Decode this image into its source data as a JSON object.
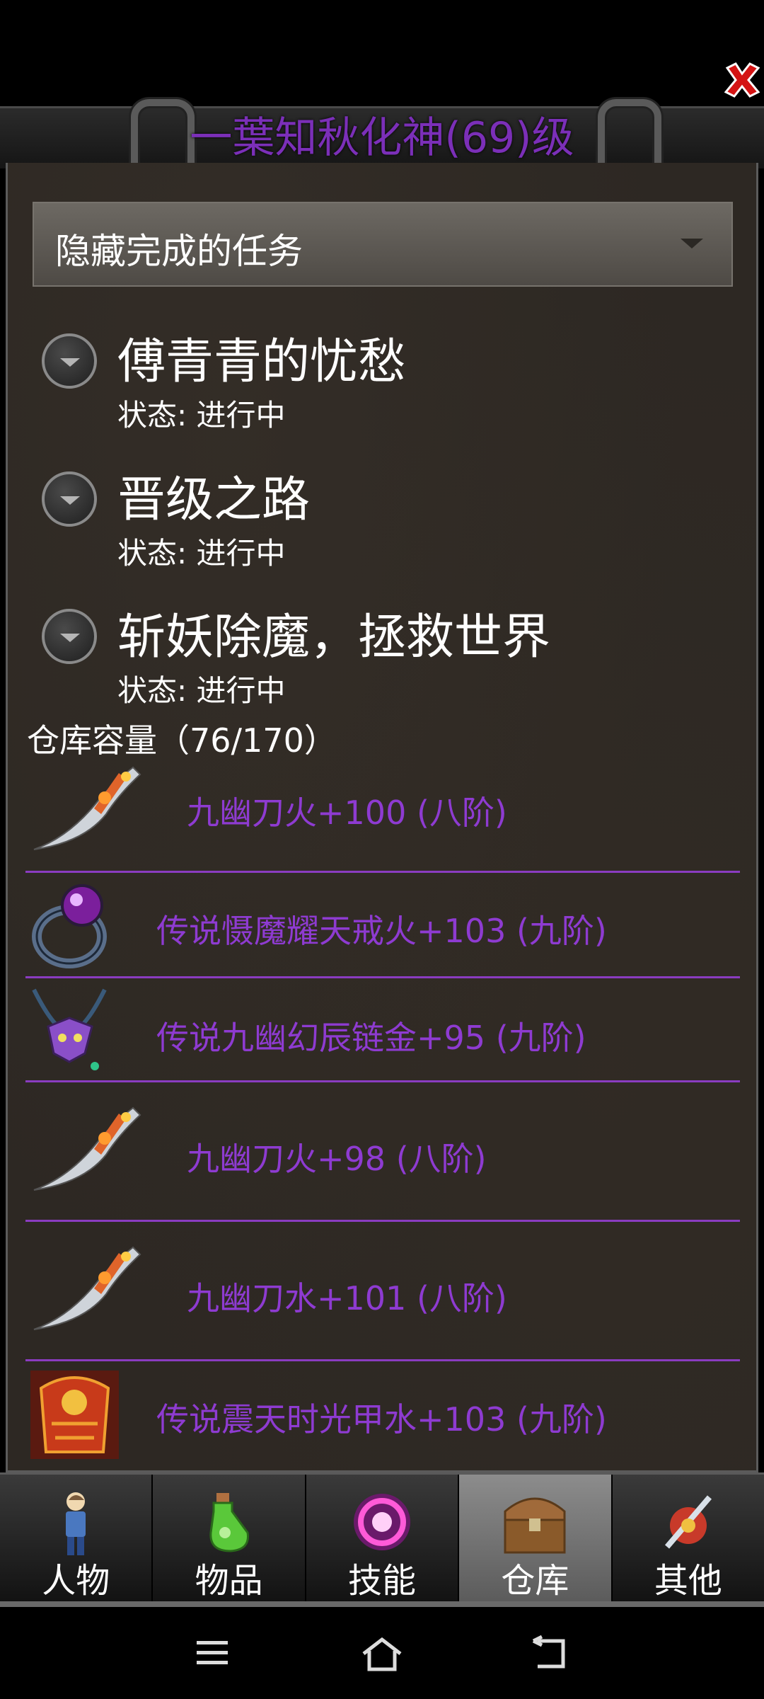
{
  "window": {
    "title": "一葉知秋化神(69)级",
    "close_icon": "close-x-icon"
  },
  "filter": {
    "selected": "隐藏完成的任务"
  },
  "quests": [
    {
      "title": "傅青青的忧愁",
      "status": "状态: 进行中"
    },
    {
      "title": "晋级之路",
      "status": "状态: 进行中"
    },
    {
      "title": "斩妖除魔，拯救世界",
      "status": "状态: 进行中"
    }
  ],
  "warehouse": {
    "capacity": "仓库容量（76/170）",
    "items": [
      {
        "name": "九幽刀火+100 (八阶)",
        "icon": "blade-icon"
      },
      {
        "name": "传说慑魔耀天戒火+103 (九阶)",
        "icon": "ring-icon"
      },
      {
        "name": "传说九幽幻辰链金+95 (九阶)",
        "icon": "necklace-icon"
      },
      {
        "name": "九幽刀火+98 (八阶)",
        "icon": "blade-icon"
      },
      {
        "name": "九幽刀水+101 (八阶)",
        "icon": "blade-icon"
      },
      {
        "name": "传说震天时光甲水+103 (九阶)",
        "icon": "armor-icon"
      }
    ]
  },
  "tabs": [
    {
      "label": "人物",
      "icon": "character-icon"
    },
    {
      "label": "物品",
      "icon": "potion-icon"
    },
    {
      "label": "技能",
      "icon": "skill-icon"
    },
    {
      "label": "仓库",
      "icon": "chest-icon",
      "active": true
    },
    {
      "label": "其他",
      "icon": "other-icon"
    }
  ],
  "system_nav": [
    "menu-icon",
    "home-icon",
    "back-icon"
  ],
  "colors": {
    "item_name": "#8e3bd1",
    "title": "#7b2fb8",
    "divider": "#8a3cc0"
  }
}
